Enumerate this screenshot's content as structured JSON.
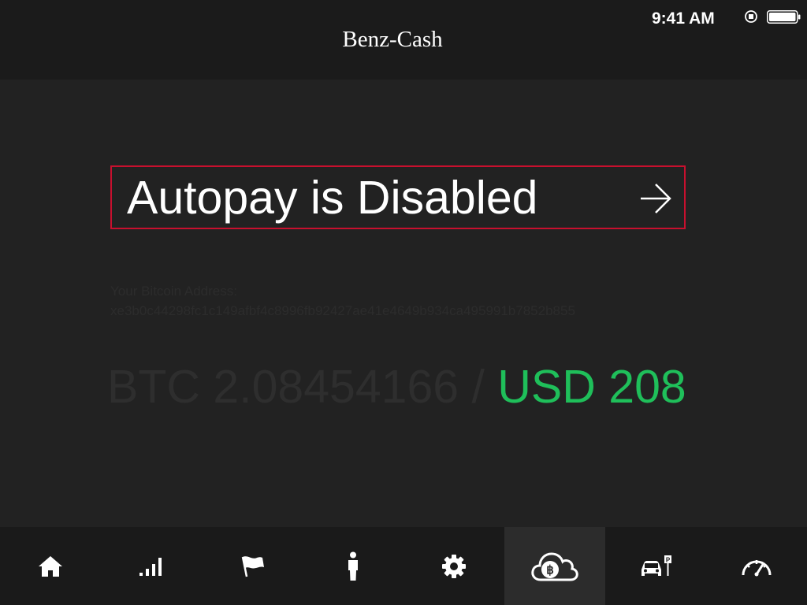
{
  "header": {
    "title": "Benz-Cash",
    "status": {
      "time": "9:41 AM",
      "status_icon": "location-lock-icon",
      "battery_icon": "battery-full-icon"
    }
  },
  "autopay": {
    "label": "Autopay is Disabled",
    "arrow_icon": "arrow-right-icon",
    "border_color": "#c8102e"
  },
  "address": {
    "label": "Your Bitcoin Address:",
    "value": "xe3b0c44298fc1c149afbf4c8996fb92427ae41e4649b934ca495991b7852b855"
  },
  "balance": {
    "btc": "BTC 2.08454166",
    "separator": " / ",
    "usd": "USD 208",
    "usd_color": "#1fbf5a"
  },
  "tabbar": {
    "active_index": 5,
    "items": [
      {
        "icon": "home-icon"
      },
      {
        "icon": "signal-bars-icon"
      },
      {
        "icon": "flag-icon"
      },
      {
        "icon": "person-icon"
      },
      {
        "icon": "gear-icon"
      },
      {
        "icon": "bitcoin-cloud-icon"
      },
      {
        "icon": "car-parking-icon"
      },
      {
        "icon": "speedometer-icon"
      }
    ]
  }
}
